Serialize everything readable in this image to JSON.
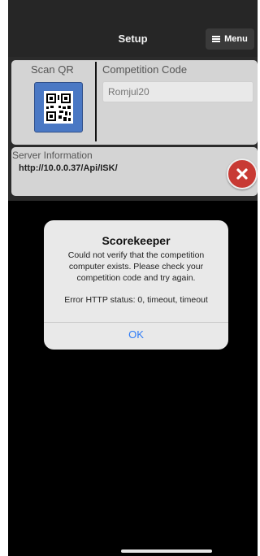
{
  "header": {
    "title": "Setup",
    "menu_label": "Menu"
  },
  "scan": {
    "label": "Scan QR"
  },
  "competition": {
    "label": "Competition Code",
    "placeholder": "Romjul20"
  },
  "server": {
    "label": "Server Information",
    "url": "http://10.0.0.37/Api/ISK/"
  },
  "alert": {
    "title": "Scorekeeper",
    "message": "Could not verify that the competition computer exists. Please check your competition code and try again.",
    "error": "Error HTTP status: 0, timeout, timeout",
    "ok_label": "OK"
  },
  "colors": {
    "accent": "#2f7cf6",
    "error": "#c83a34",
    "qr_button": "#4a78c4"
  }
}
